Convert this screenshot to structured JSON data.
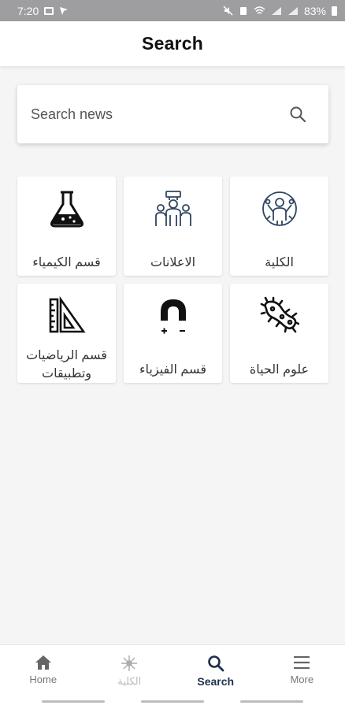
{
  "status_bar": {
    "time": "7:20",
    "battery_percent": "83%"
  },
  "header": {
    "title": "Search"
  },
  "search": {
    "placeholder": "Search news",
    "icon": "search-icon"
  },
  "categories": [
    {
      "label": "قسم الكيمياء",
      "icon": "flask-icon"
    },
    {
      "label": "الاعلانات",
      "icon": "megaphone-crowd-icon"
    },
    {
      "label": "الكلية",
      "icon": "scientist-icon"
    },
    {
      "label": "قسم الرياضيات وتطبيقات",
      "icon": "ruler-triangle-icon"
    },
    {
      "label": "قسم الفيزياء",
      "icon": "magnet-icon"
    },
    {
      "label": "علوم الحياة",
      "icon": "bacteria-icon"
    }
  ],
  "bottom_nav": {
    "items": [
      {
        "label": "Home",
        "icon": "home-icon",
        "active": false
      },
      {
        "label": "الكلية",
        "icon": "atom-icon",
        "active": false
      },
      {
        "label": "Search",
        "icon": "search-icon",
        "active": true
      },
      {
        "label": "More",
        "icon": "menu-icon",
        "active": false
      }
    ]
  },
  "colors": {
    "active_nav": "#1f2f4f",
    "status_bar": "#9e9ea0"
  }
}
